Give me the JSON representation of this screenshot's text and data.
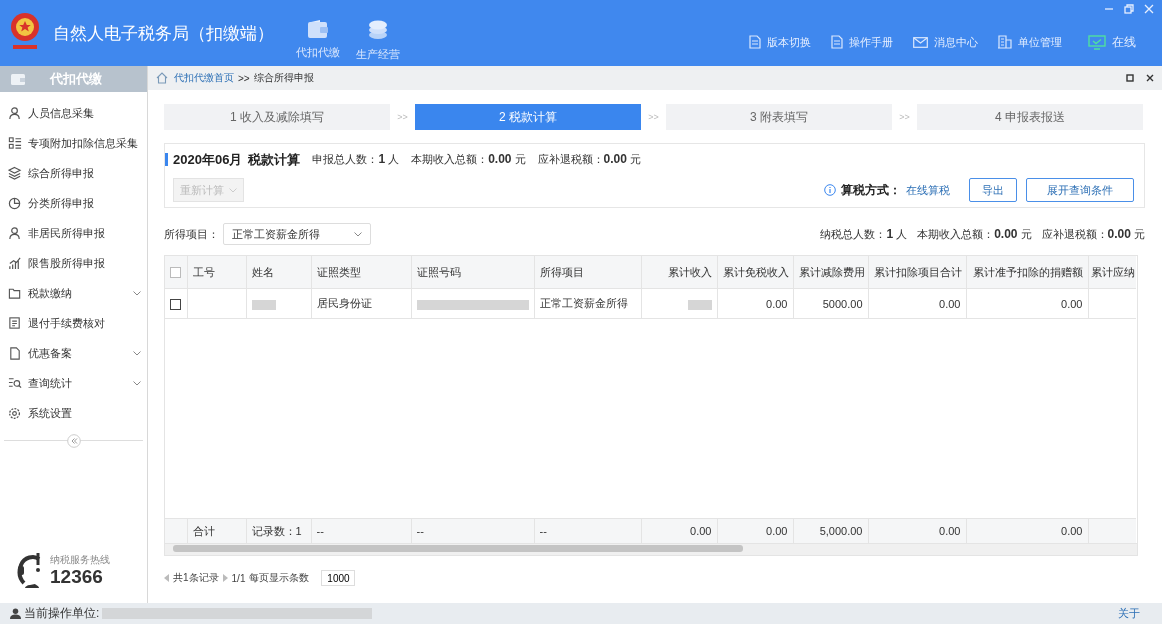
{
  "window": {
    "title": "自然人电子税务局（扣缴端）"
  },
  "header_nav": [
    {
      "label": "代扣代缴"
    },
    {
      "label": "生产经营"
    }
  ],
  "toolbar": [
    {
      "label": "版本切换"
    },
    {
      "label": "操作手册"
    },
    {
      "label": "消息中心"
    },
    {
      "label": "单位管理"
    },
    {
      "label": "在线"
    }
  ],
  "sidebar": {
    "title": "代扣代缴",
    "items": [
      {
        "label": "人员信息采集",
        "expandable": false
      },
      {
        "label": "专项附加扣除信息采集",
        "expandable": false
      },
      {
        "label": "综合所得申报",
        "expandable": false
      },
      {
        "label": "分类所得申报",
        "expandable": false
      },
      {
        "label": "非居民所得申报",
        "expandable": false
      },
      {
        "label": "限售股所得申报",
        "expandable": false
      },
      {
        "label": "税款缴纳",
        "expandable": true
      },
      {
        "label": "退付手续费核对",
        "expandable": false
      },
      {
        "label": "优惠备案",
        "expandable": true
      },
      {
        "label": "查询统计",
        "expandable": true
      },
      {
        "label": "系统设置",
        "expandable": false
      }
    ],
    "hotline": {
      "label": "纳税服务热线",
      "number": "12366"
    }
  },
  "breadcrumb": {
    "home": "代扣代缴首页",
    "separator": ">>",
    "current": "综合所得申报"
  },
  "steps": [
    {
      "label": "1 收入及减除填写",
      "selected": false,
      "next_separator": ">>"
    },
    {
      "label": "2 税款计算",
      "selected": true,
      "next_separator": ">>"
    },
    {
      "label": "3 附表填写",
      "selected": false,
      "next_separator": ">>"
    },
    {
      "label": "4 申报表报送",
      "selected": false
    }
  ],
  "summary": {
    "period": "2020年06月",
    "title": "税款计算",
    "stats": [
      "申报总人数：**1** 人",
      "本期收入总额：**0.00** 元",
      "应补退税额：**0.00** 元"
    ],
    "recalculate_button": {
      "label": "重新计算",
      "disabled": true
    },
    "method_label": "算税方式：",
    "method_link": "在线算税",
    "buttons": [
      "导出",
      "展开查询条件"
    ]
  },
  "filter": {
    "label": "所得项目：",
    "value": "正常工资薪金所得",
    "stats": [
      "纳税总人数：**1** 人",
      "本期收入总额：**0.00** 元",
      "应补退税额：**0.00** 元"
    ]
  },
  "table": {
    "header_checked": false,
    "columns": [
      {
        "label": "工号"
      },
      {
        "label": "姓名"
      },
      {
        "label": "证照类型"
      },
      {
        "label": "证照号码"
      },
      {
        "label": "所得项目"
      },
      {
        "label": "累计收入"
      },
      {
        "label": "累计免税收入"
      },
      {
        "label": "累计减除费用"
      },
      {
        "label": "累计扣除项目合计"
      },
      {
        "label": "累计准予扣除的捐赠额"
      },
      {
        "label": "累计应纳"
      }
    ],
    "rows": [
      {
        "checked": false,
        "cells": [
          {
            "kind": "empty"
          },
          {
            "kind": "redacted"
          },
          {
            "kind": "text",
            "text": "居民身份证"
          },
          {
            "kind": "redacted"
          },
          {
            "kind": "text",
            "text": "正常工资薪金所得"
          },
          {
            "kind": "redacted"
          },
          {
            "kind": "text",
            "text": "0.00"
          },
          {
            "kind": "text",
            "text": "5000.00"
          },
          {
            "kind": "text",
            "text": "0.00"
          },
          {
            "kind": "text",
            "text": "0.00"
          },
          {
            "kind": "empty"
          }
        ]
      }
    ],
    "total": [
      {
        "kind": "text",
        "text": "合计"
      },
      {
        "kind": "text",
        "text": "记录数：1"
      },
      {
        "kind": "text",
        "text": "--"
      },
      {
        "kind": "text",
        "text": "--"
      },
      {
        "kind": "text",
        "text": "--"
      },
      {
        "kind": "text",
        "text": "0.00"
      },
      {
        "kind": "text",
        "text": "0.00"
      },
      {
        "kind": "text",
        "text": "5,000.00"
      },
      {
        "kind": "text",
        "text": "0.00"
      },
      {
        "kind": "text",
        "text": "0.00"
      },
      {
        "kind": "empty"
      }
    ]
  },
  "pagination": {
    "records": "共1条记录",
    "page": "1/1",
    "page_size_label": "每页显示条数",
    "page_size": "1000"
  },
  "status_bar": {
    "unit_label": "当前操作单位:",
    "unit_redacted": true,
    "about": "关于"
  }
}
